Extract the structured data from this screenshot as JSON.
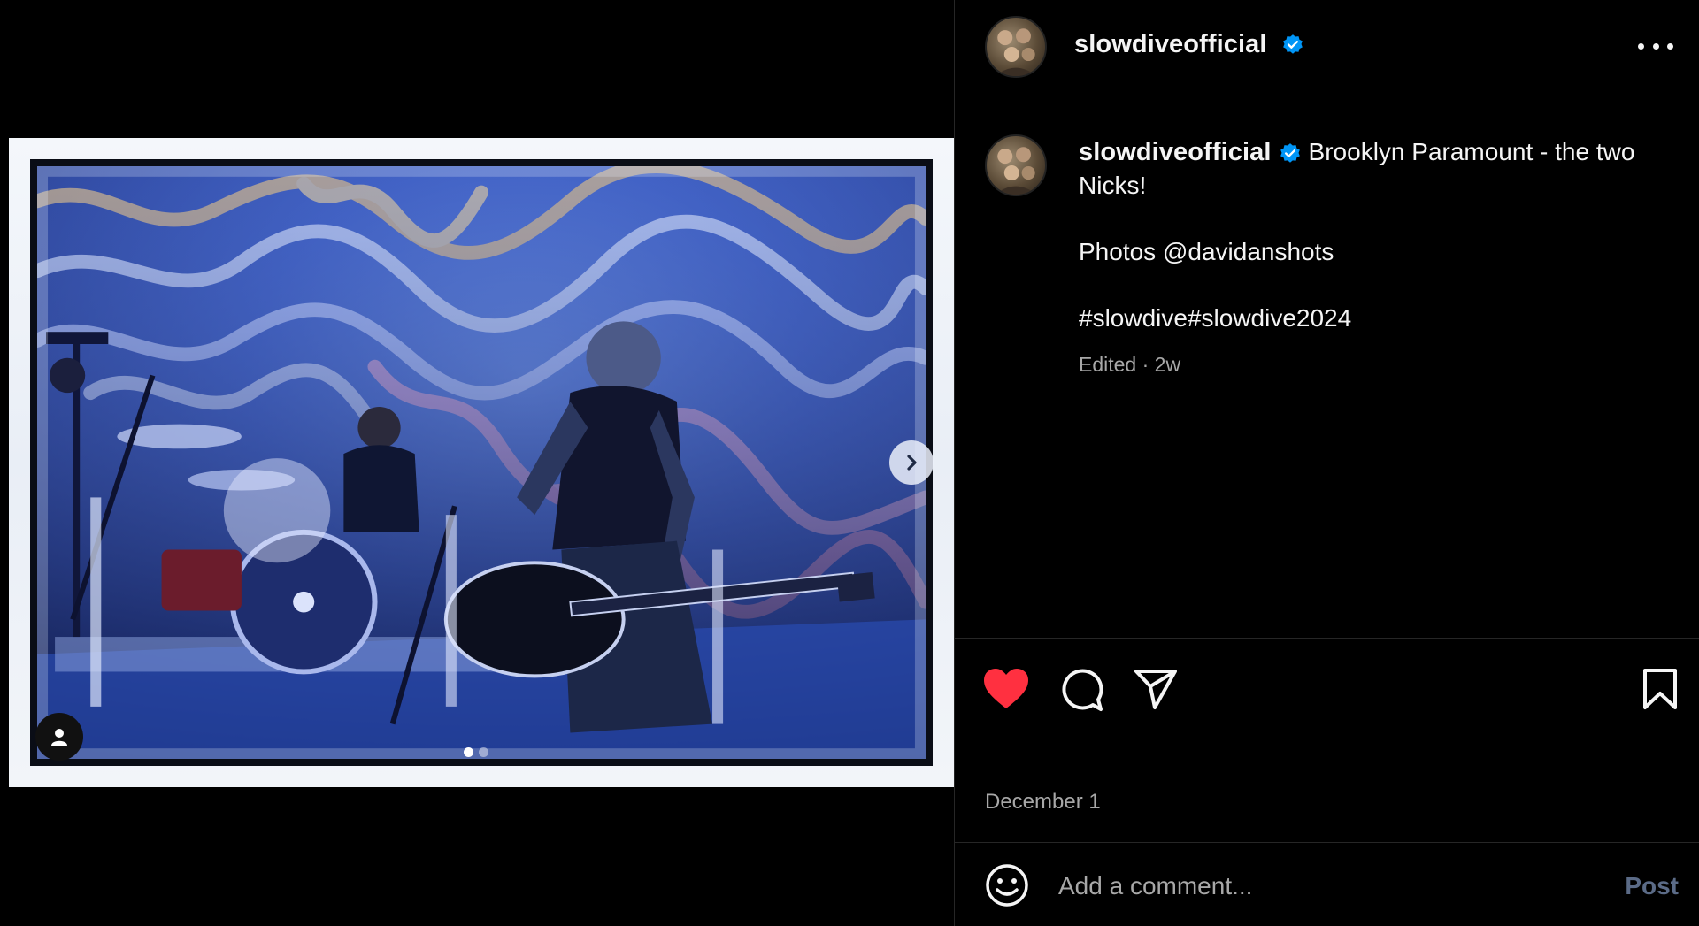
{
  "post": {
    "username": "slowdiveofficial",
    "verified_icon": "verified-badge-icon",
    "caption": {
      "line1": "Brooklyn Paramount - the two Nicks!",
      "line2": "Photos @davidanshots",
      "line3": "#slowdive#slowdive2024",
      "meta": "Edited · 2w"
    },
    "date": "December 1",
    "liked": true
  },
  "media": {
    "image_description_icon": "concert-photo",
    "carousel": {
      "current": 1,
      "total": 2
    }
  },
  "comment": {
    "placeholder": "Add a comment...",
    "post_label": "Post"
  },
  "colors": {
    "background": "#000000",
    "like_red": "#ff3040",
    "verified_blue": "#0095f6",
    "muted_text": "#a8a8a8",
    "post_disabled": "#5b6b87"
  }
}
